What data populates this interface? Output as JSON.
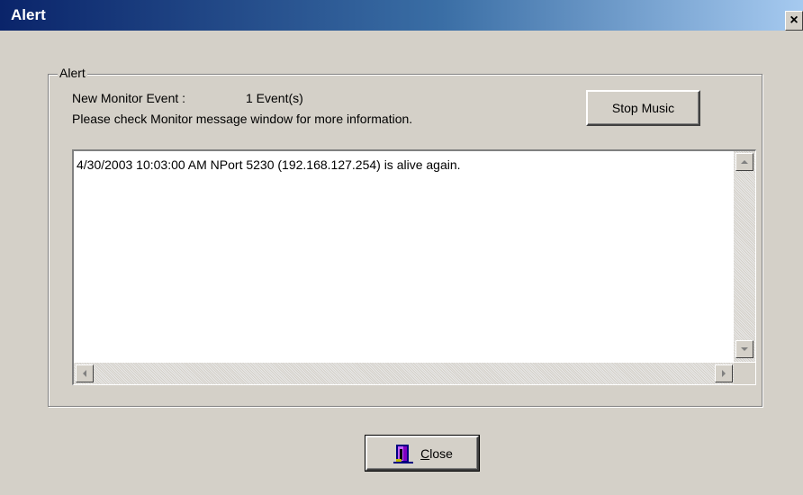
{
  "window": {
    "title": "Alert",
    "close_glyph": "×"
  },
  "group": {
    "legend": "Alert",
    "new_event_label": "New Monitor Event :",
    "new_event_count": "1 Event(s)",
    "info_text": "Please check Monitor message window for more information."
  },
  "buttons": {
    "stop_music": "Stop Music",
    "close_accel": "C",
    "close_rest": "lose"
  },
  "messages": [
    "4/30/2003 10:03:00 AM NPort 5230 (192.168.127.254) is alive again."
  ],
  "icons": {
    "close_button_icon": "door-exit-icon"
  },
  "colors": {
    "titlebar_start": "#0a246a",
    "titlebar_end": "#a6caf0",
    "dialog_bg": "#d4d0c8"
  }
}
